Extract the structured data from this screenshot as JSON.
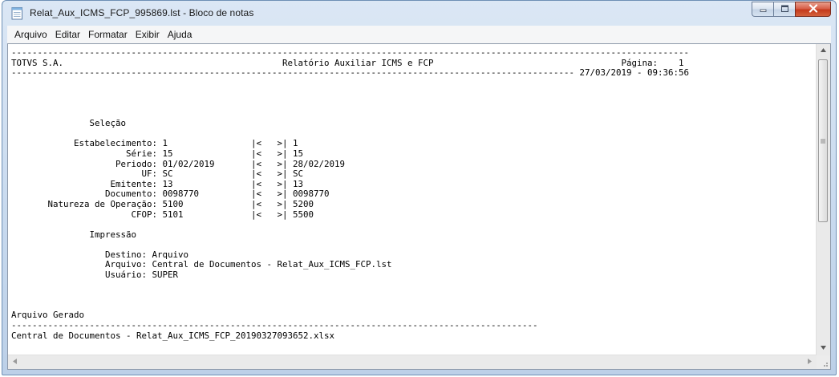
{
  "window": {
    "title": "Relat_Aux_ICMS_FCP_995869.lst - Bloco de notas"
  },
  "icons": {
    "app": "notepad-icon",
    "minimize": "minimize-icon",
    "maximize": "maximize-icon",
    "close": "close-icon",
    "scroll_up": "arrow-up-icon",
    "scroll_down": "arrow-down-icon",
    "scroll_left": "arrow-left-icon",
    "scroll_right": "arrow-right-icon",
    "size_grip": "resize-grip-icon"
  },
  "colors": {
    "close_button": "#c43a1c",
    "frame": "#c7d9ee",
    "menubar": "#f5f6f7",
    "editor_bg": "#ffffff"
  },
  "menu": {
    "items": [
      "Arquivo",
      "Editar",
      "Formatar",
      "Exibir",
      "Ajuda"
    ]
  },
  "document": {
    "lines": [
      "----------------------------------------------------------------------------------------------------------------------------------",
      "TOTVS S.A.                                          Relatório Auxiliar ICMS e FCP                                    Página:    1",
      "------------------------------------------------------------------------------------------------------------ 27/03/2019 - 09:36:56",
      "",
      "",
      "",
      "",
      "               Seleção",
      "",
      "            Estabelecimento: 1                |<   >| 1",
      "                      Série: 15               |<   >| 15",
      "                    Periodo: 01/02/2019       |<   >| 28/02/2019",
      "                         UF: SC               |<   >| SC",
      "                   Emitente: 13               |<   >| 13",
      "                  Documento: 0098770          |<   >| 0098770",
      "       Natureza de Operação: 5100             |<   >| 5200",
      "                       CFOP: 5101             |<   >| 5500",
      "",
      "               Impressão",
      "",
      "                  Destino: Arquivo",
      "                  Arquivo: Central de Documentos - Relat_Aux_ICMS_FCP.lst",
      "                  Usuário: SUPER",
      "",
      "",
      "",
      "Arquivo Gerado",
      "-----------------------------------------------------------------------------------------------------",
      "Central de Documentos - Relat_Aux_ICMS_FCP_20190327093652.xlsx"
    ]
  }
}
